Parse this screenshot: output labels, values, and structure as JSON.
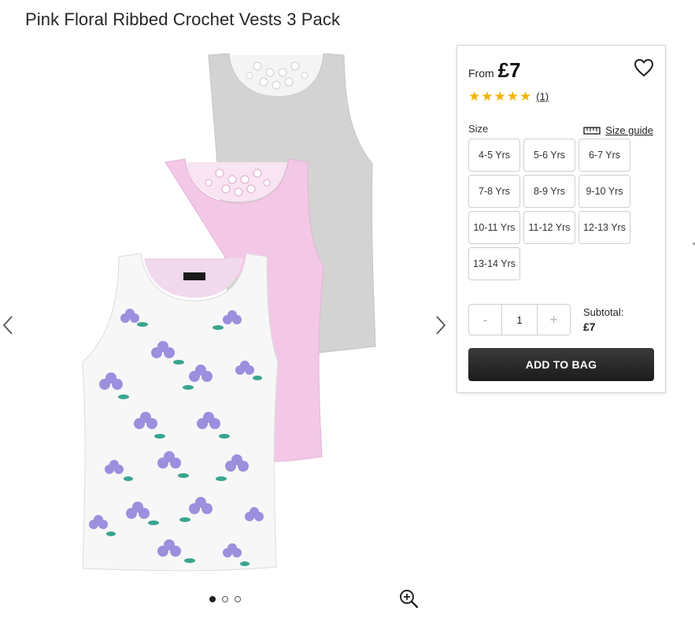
{
  "product": {
    "title": "Pink Floral Ribbed Crochet Vests 3 Pack",
    "image_alt": "Three children's vests: grey, pink and white floral"
  },
  "gallery": {
    "slides": 3,
    "active_slide": 1,
    "prev_icon": "chevron-left-icon",
    "next_icon": "chevron-right-icon",
    "zoom_icon": "zoom-in-icon"
  },
  "purchase": {
    "from_label": "From",
    "price": "£7",
    "rating": {
      "stars": 5,
      "count_text": "(1)"
    },
    "size_label": "Size",
    "size_guide_label": "Size guide",
    "sizes": [
      "4-5 Yrs",
      "5-6 Yrs",
      "6-7 Yrs",
      "7-8 Yrs",
      "8-9 Yrs",
      "9-10 Yrs",
      "10-11 Yrs",
      "11-12 Yrs",
      "12-13 Yrs",
      "13-14 Yrs"
    ],
    "quantity": {
      "minus": "-",
      "value": "1",
      "plus": "+"
    },
    "subtotal_label": "Subtotal:",
    "subtotal_value": "£7",
    "add_to_bag_label": "ADD TO BAG"
  },
  "colors": {
    "star": "#f5b400",
    "button_dark": "#222222",
    "grey_vest": "#cfcfcf",
    "pink_vest": "#f1c6e4",
    "floral_vest": "#f7f7f7",
    "flower": "#9c8fde",
    "leaf": "#3aa58f"
  }
}
